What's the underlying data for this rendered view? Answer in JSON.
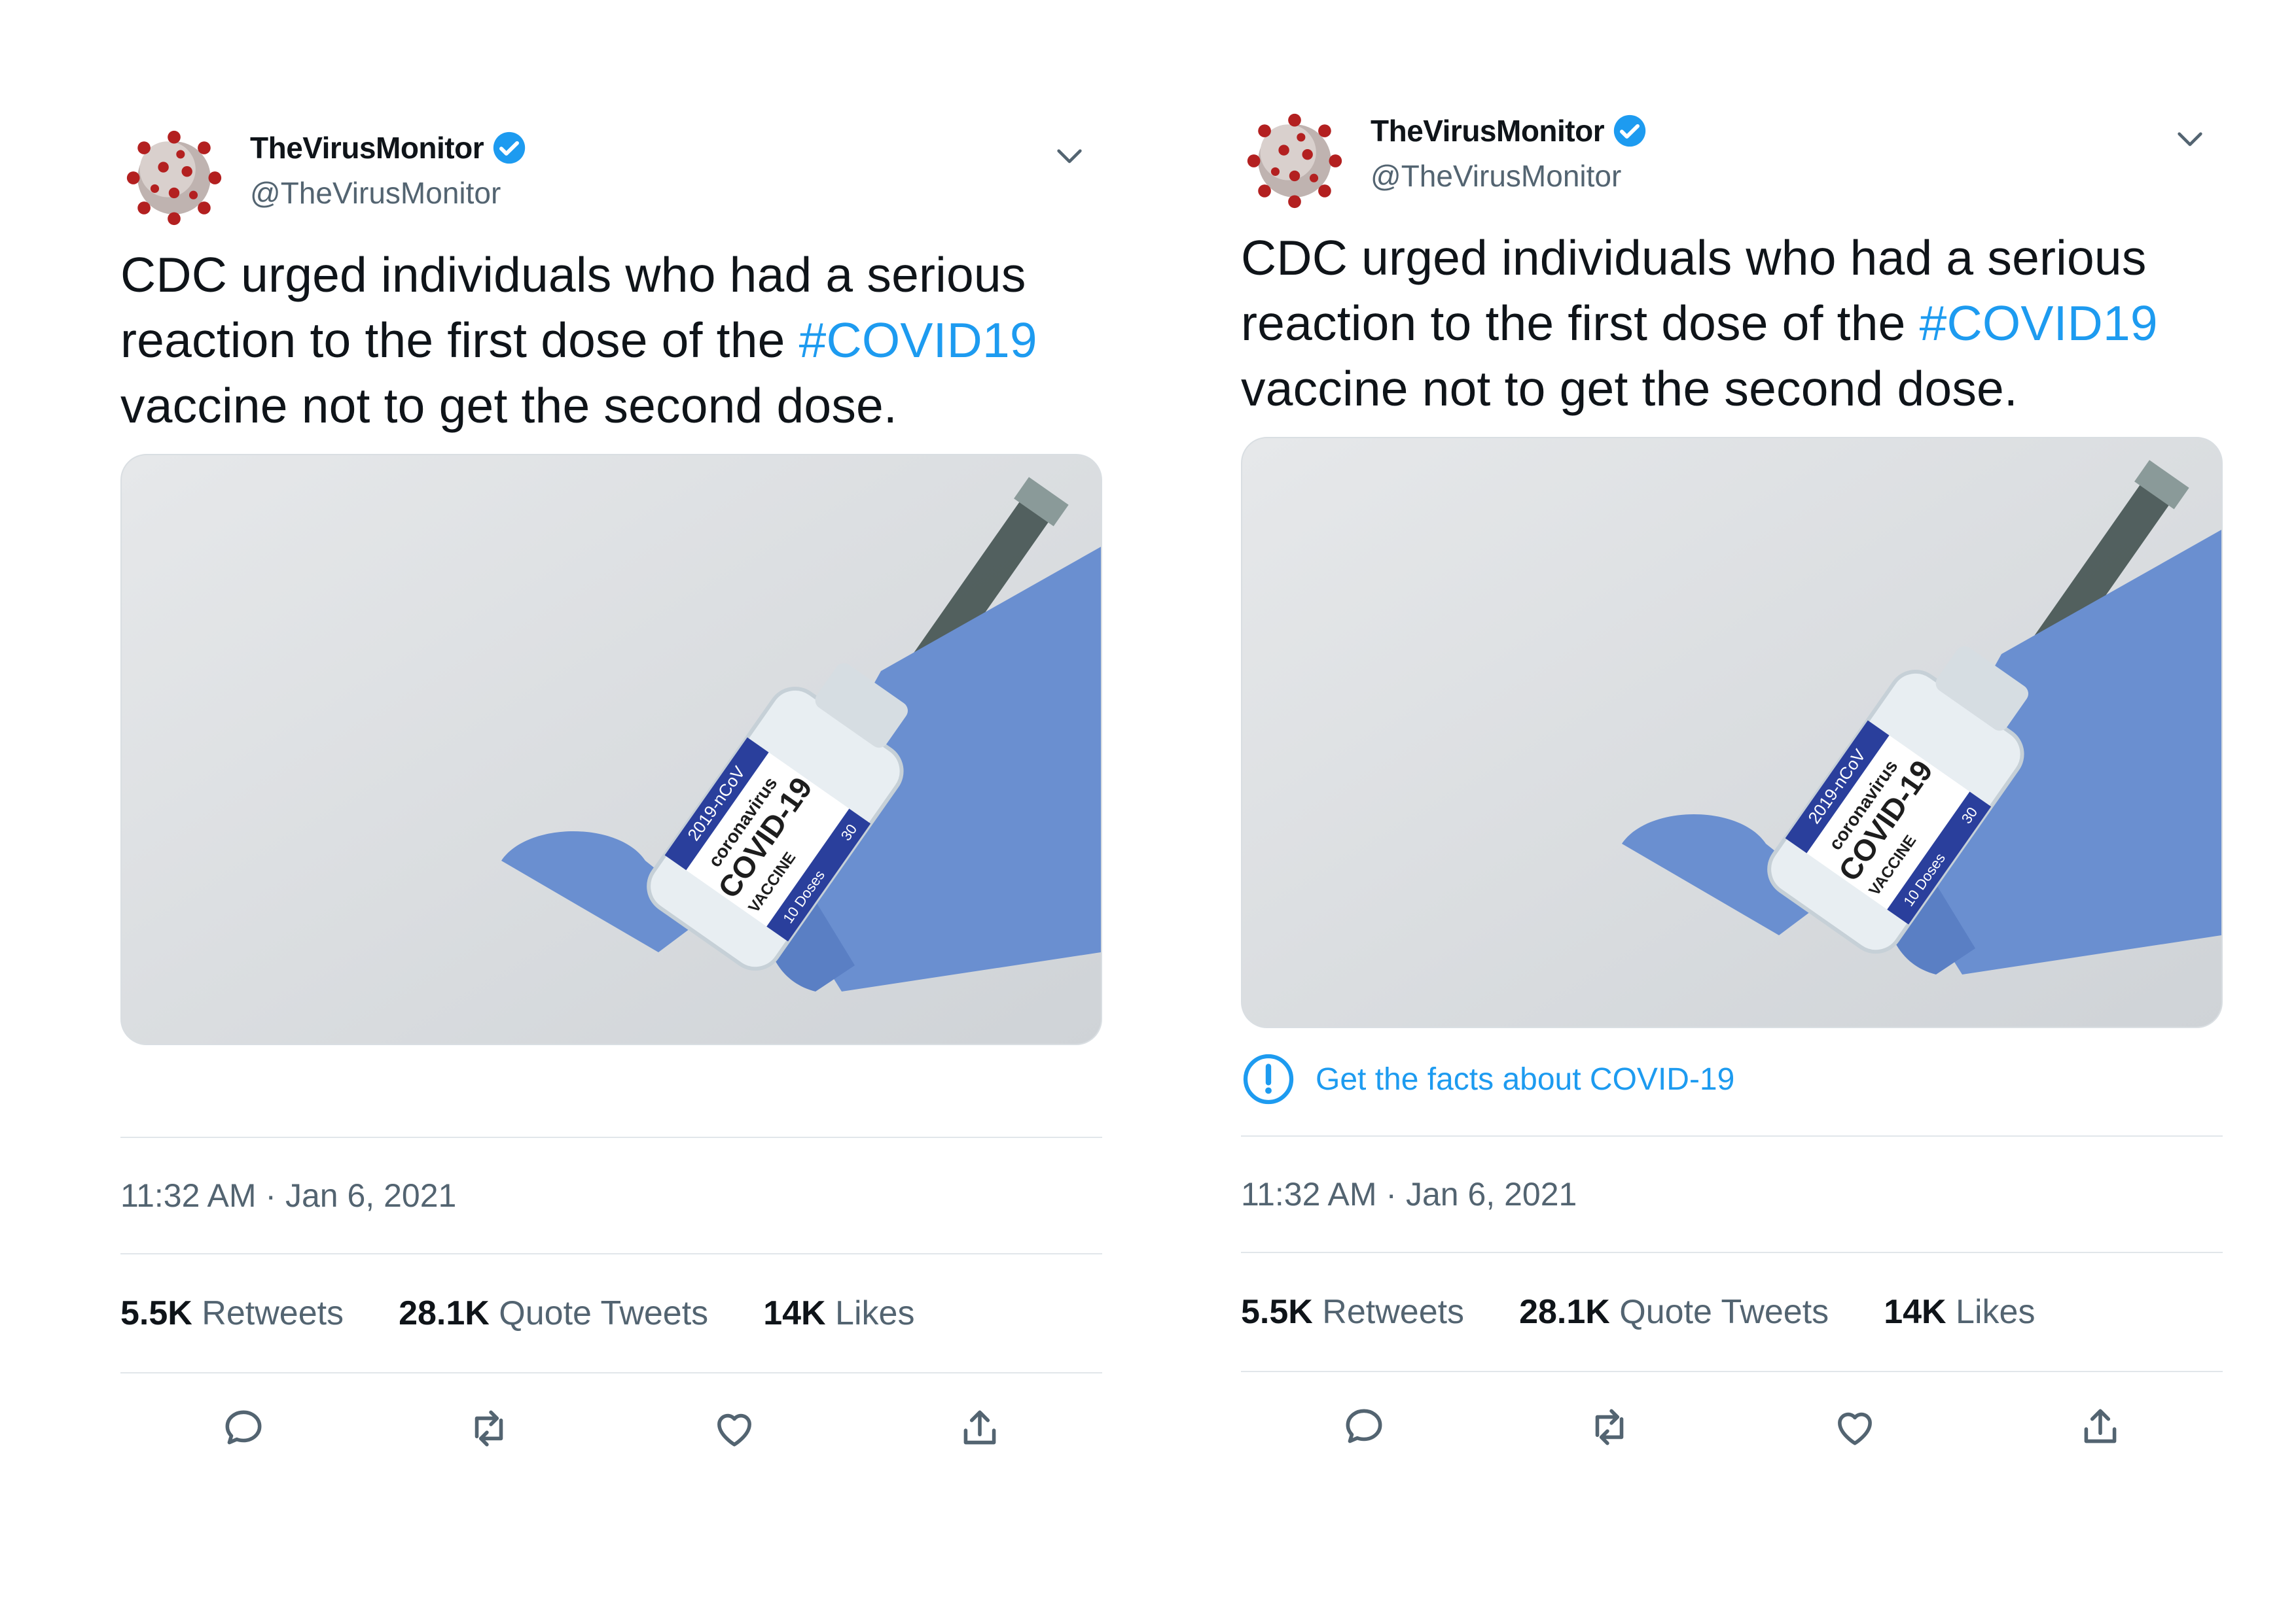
{
  "tweets": [
    {
      "author": {
        "display_name": "TheVirusMonitor",
        "handle": "@TheVirusMonitor",
        "verified": true
      },
      "text_before": "CDC urged individuals who had a serious reaction to the first dose of the ",
      "hashtag": "#COVID19",
      "text_after": " vaccine not to get the second dose.",
      "media": {
        "label_line1": "2019-nCoV",
        "label_line2": "coronavirus",
        "label_line3": "COVID-19",
        "label_line4": "VACCINE",
        "label_line5": "10 Doses",
        "label_line6": "30"
      },
      "facts_link": null,
      "timestamp": "11:32 AM · Jan 6, 2021",
      "stats": {
        "retweets_count": "5.5K",
        "retweets_label": "Retweets",
        "quotes_count": "28.1K",
        "quotes_label": "Quote Tweets",
        "likes_count": "14K",
        "likes_label": "Likes"
      },
      "actions": [
        "reply-icon",
        "retweet-icon",
        "like-icon",
        "share-icon"
      ]
    },
    {
      "author": {
        "display_name": "TheVirusMonitor",
        "handle": "@TheVirusMonitor",
        "verified": true
      },
      "text_before": "CDC urged individuals who had a serious reaction to the first dose of the ",
      "hashtag": "#COVID19",
      "text_after": " vaccine not to get the second dose.",
      "media": {
        "label_line1": "2019-nCoV",
        "label_line2": "coronavirus",
        "label_line3": "COVID-19",
        "label_line4": "VACCINE",
        "label_line5": "10 Doses",
        "label_line6": "30"
      },
      "facts_link": "Get the facts about COVID-19",
      "timestamp": "11:32 AM · Jan 6, 2021",
      "stats": {
        "retweets_count": "5.5K",
        "retweets_label": "Retweets",
        "quotes_count": "28.1K",
        "quotes_label": "Quote Tweets",
        "likes_count": "14K",
        "likes_label": "Likes"
      },
      "actions": [
        "reply-icon",
        "retweet-icon",
        "like-icon",
        "share-icon"
      ]
    }
  ],
  "colors": {
    "link": "#1d9bf0",
    "muted": "#536471",
    "text": "#0f1419",
    "verified": "#1d9bf0",
    "glove": "#6a8fd0"
  }
}
